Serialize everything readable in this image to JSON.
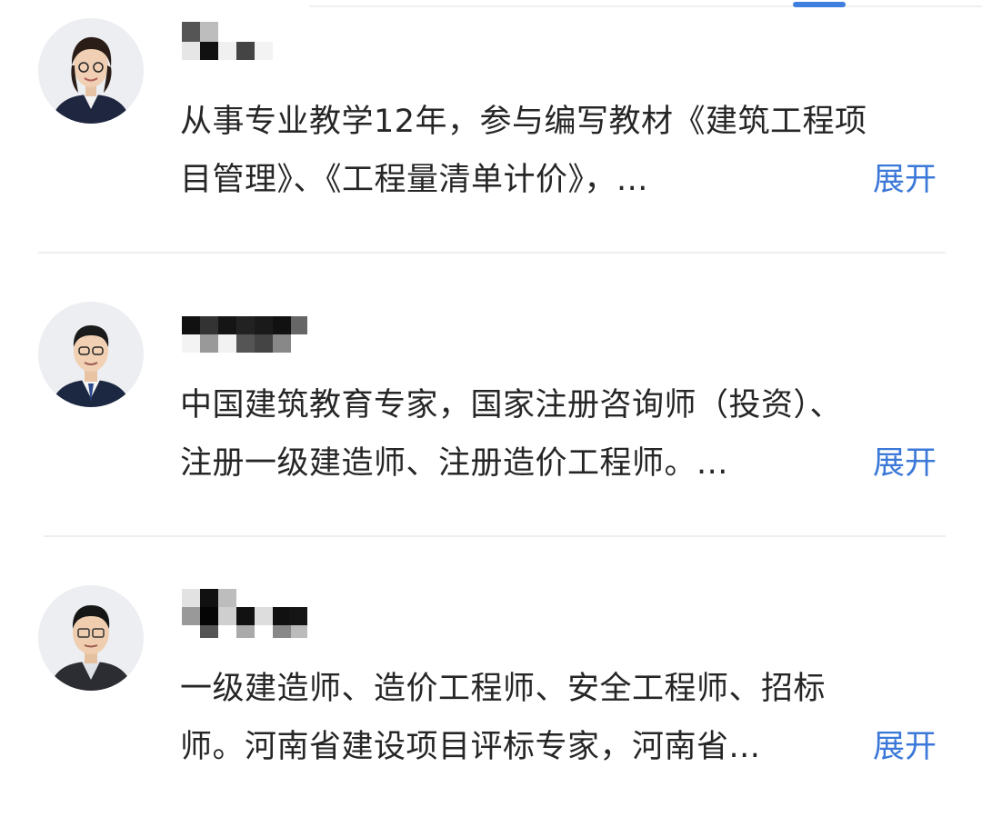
{
  "experts": [
    {
      "avatar_icon": "female-teacher-avatar-icon",
      "description_line1": "从事专业教学12年，参与编写教材《建筑工程项",
      "description_line2": "目管理》、《工程量清单计价》，...",
      "expand_label": "展开"
    },
    {
      "avatar_icon": "male-teacher-avatar-icon",
      "description_line1": "中国建筑教育专家，国家注册咨询师（投资）、",
      "description_line2": "注册一级建造师、注册造价工程师。...",
      "expand_label": "展开"
    },
    {
      "avatar_icon": "male-teacher-avatar-icon",
      "description_line1": "一级建造师、造价工程师、安全工程师、招标",
      "description_line2": "师。河南省建设项目评标专家，河南省...",
      "expand_label": "展开"
    }
  ],
  "colors": {
    "accent": "#3b78d8",
    "text": "#262626",
    "divider": "#eeeeee",
    "tab_indicator": "#3f7fe0"
  }
}
